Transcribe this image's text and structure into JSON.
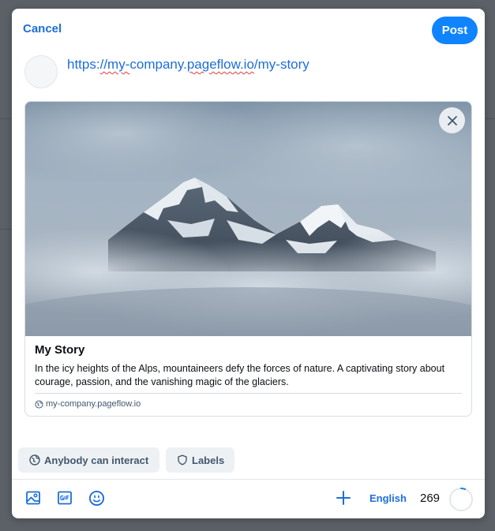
{
  "dialog": {
    "cancel_label": "Cancel",
    "post_label": "Post"
  },
  "post": {
    "text_prefix": "https:",
    "text_misspelled_1": "//my-",
    "text_middle": "company.",
    "text_misspelled_2": "pageflow.io",
    "text_suffix": "/my-story"
  },
  "link_card": {
    "title": "My Story",
    "description": "In the icy heights of the Alps, mountaineers defy the forces of nature. A captivating story about courage, passion, and the vanishing magic of the glaciers.",
    "domain": "my-company.pageflow.io"
  },
  "controls": {
    "interaction_label": "Anybody can interact",
    "labels_label": "Labels"
  },
  "toolbar": {
    "icons": [
      "image-icon",
      "gif-icon",
      "emoji-icon",
      "plus-icon"
    ],
    "language": "English",
    "chars_remaining": "269",
    "progress_fraction": 0.06
  },
  "colors": {
    "accent": "#1083fe",
    "link": "#1d6ed8",
    "muted": "#42576c"
  }
}
